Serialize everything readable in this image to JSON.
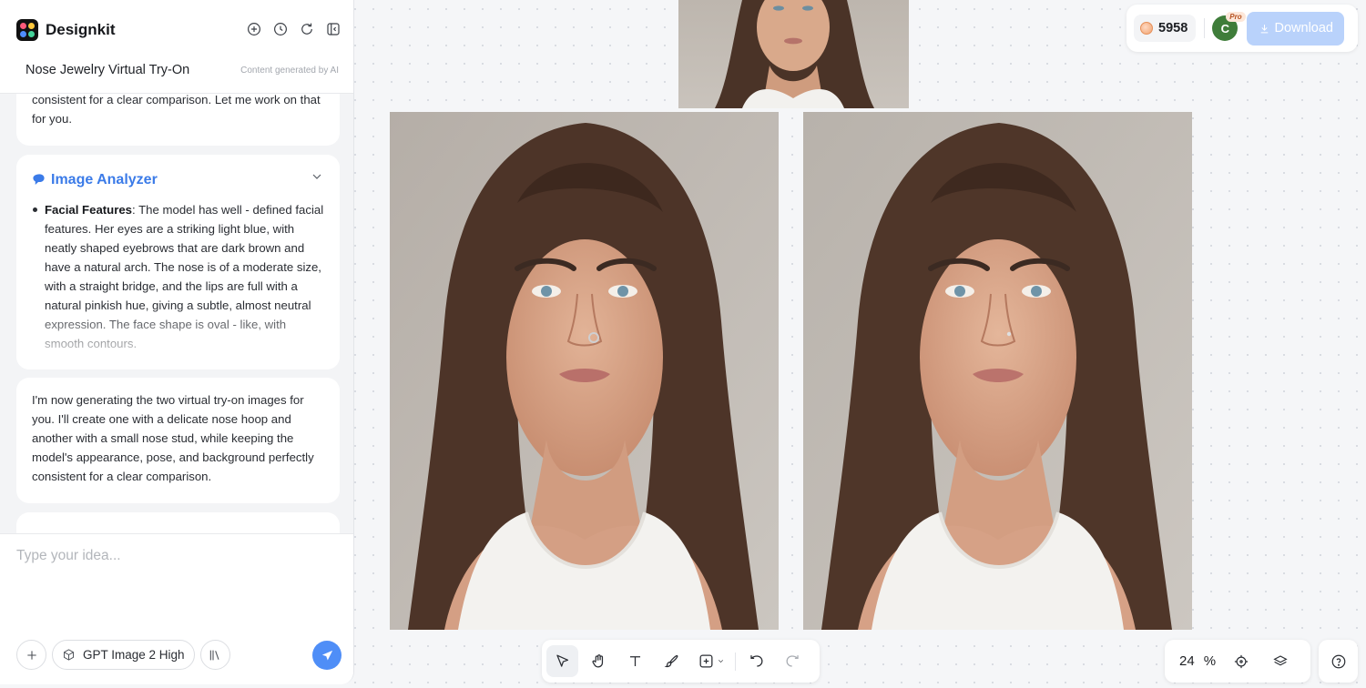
{
  "app": {
    "name": "Designkit",
    "chat_title": "Nose Jewelry Virtual Try-On",
    "generated_note": "Content generated by AI"
  },
  "messages": {
    "m1": "consistent for a clear comparison. Let me work on that for you.",
    "analyzer": {
      "title": "Image Analyzer",
      "bullet_label": "Facial Features",
      "bullet_text": ": The model has well - defined facial features. Her eyes are a striking light blue, with neatly shaped eyebrows that are dark brown and have a natural arch. The nose is of a moderate size, with a straight bridge, and the lips are full with a natural pinkish hue, giving a subtle, almost neutral expression. The face shape is oval - like, with smooth contours."
    },
    "m3": "I'm now generating the two virtual try-on images for you. I'll create one with a delicate nose hoop and another with a small nose stud, while keeping the model's appearance, pose, and background perfectly consistent for a clear comparison."
  },
  "composer": {
    "placeholder": "Type your idea...",
    "model_label": "GPT Image 2 High"
  },
  "topbar": {
    "credits": "5958",
    "avatar_initial": "C",
    "badge": "Pro",
    "download_label": "Download"
  },
  "zoom": {
    "value": "24",
    "unit": "%"
  },
  "colors": {
    "accent": "#4f8ef7",
    "analyzer_title": "#3b7be8",
    "download_disabled": "#b9d2fb",
    "avatar": "#3f7d3a"
  },
  "icons": {
    "header": [
      "new-chat-icon",
      "history-icon",
      "refresh-icon",
      "collapse-panel-icon"
    ],
    "toolbar": [
      "select-icon",
      "hand-icon",
      "text-icon",
      "brush-icon",
      "insert-icon",
      "undo-icon",
      "redo-icon"
    ],
    "zoombar": [
      "fit-screen-icon",
      "layers-icon",
      "help-icon"
    ]
  }
}
